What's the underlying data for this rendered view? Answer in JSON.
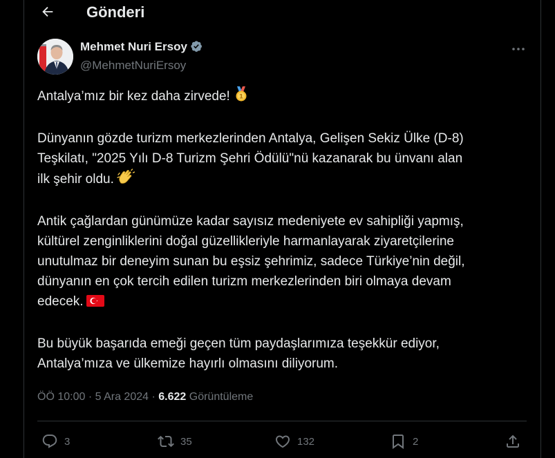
{
  "header": {
    "title": "Gönderi"
  },
  "author": {
    "name": "Mehmet Nuri Ersoy",
    "handle": "@MehmetNuriErsoy",
    "verified": true
  },
  "tweet": {
    "paragraphs": [
      "Antalya’mız bir kez daha zirvede!",
      "Dünyanın gözde turizm merkezlerinden Antalya, Gelişen Sekiz Ülke (D-8)\nTeşkilatı, \"2025 Yılı D-8 Turizm Şehri Ödülü\"nü kazanarak bu ünvanı alan\nilk şehir oldu.",
      "Antik çağlardan günümüze kadar sayısız medeniyete ev sahipliği yapmış,\nkültürel zenginliklerini doğal güzellikleriyle harmanlayarak ziyaretçilerine\nunutulmaz bir deneyim sunan bu eşsiz şehrimiz, sadece Türkiye’nin değil,\ndünyanın en çok tercih edilen turizm merkezlerinden biri olmaya devam\nedecek.",
      "Bu büyük başarıda emeği geçen tüm paydaşlarımıza teşekkür ediyor,\nAntalya’mıza ve ülkemize hayırlı olmasını diliyorum."
    ],
    "emojis": [
      "medal-icon",
      "clapping-hands-icon",
      "turkey-flag-icon"
    ]
  },
  "meta": {
    "time": "ÖÖ 10:00",
    "sep1": "·",
    "date": "5 Ara 2024",
    "sep2": "·",
    "views_count": "6.622",
    "views_label": "Görüntüleme"
  },
  "actions": {
    "replies": "3",
    "reposts": "35",
    "likes": "132",
    "bookmarks": "2"
  },
  "colors": {
    "background": "#000000",
    "text": "#e7e9ea",
    "muted": "#71767b",
    "border": "#2f3336",
    "verified": "#829aab"
  }
}
